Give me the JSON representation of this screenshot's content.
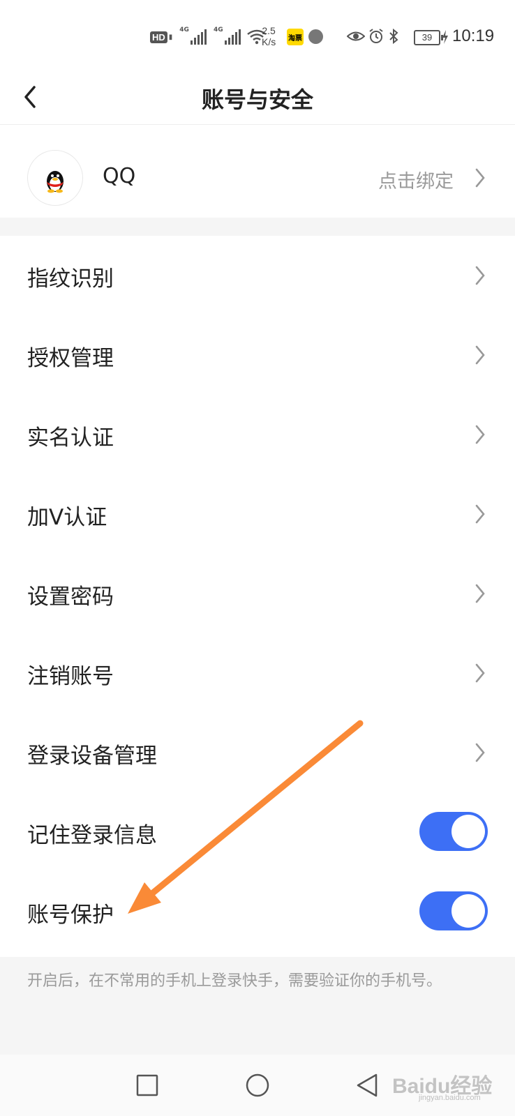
{
  "status_bar": {
    "hd": "HD",
    "sim1": "4G",
    "sim2": "4G",
    "speed_value": "2.5",
    "speed_unit": "K/s",
    "taobao": "淘票",
    "battery": "39",
    "time": "10:19"
  },
  "header": {
    "title": "账号与安全",
    "back_icon": "chevron-left-icon"
  },
  "qq": {
    "label": "QQ",
    "action": "点击绑定",
    "icon": "qq-penguin-icon"
  },
  "menu": {
    "fingerprint": "指纹识别",
    "authorization": "授权管理",
    "realname": "实名认证",
    "verify_v": "加V认证",
    "set_password": "设置密码",
    "cancel_account": "注销账号",
    "device_mgmt": "登录设备管理",
    "remember_login": "记住登录信息",
    "account_protect": "账号保护"
  },
  "toggles": {
    "remember_login_on": true,
    "account_protect_on": true,
    "color": "#3d6ff5"
  },
  "note": "开启后，在不常用的手机上登录快手，需要验证你的手机号。",
  "annotation_arrow_color": "#fa8a37",
  "watermark": {
    "brand": "Baidu经验",
    "url": "jingyan.baidu.com"
  }
}
